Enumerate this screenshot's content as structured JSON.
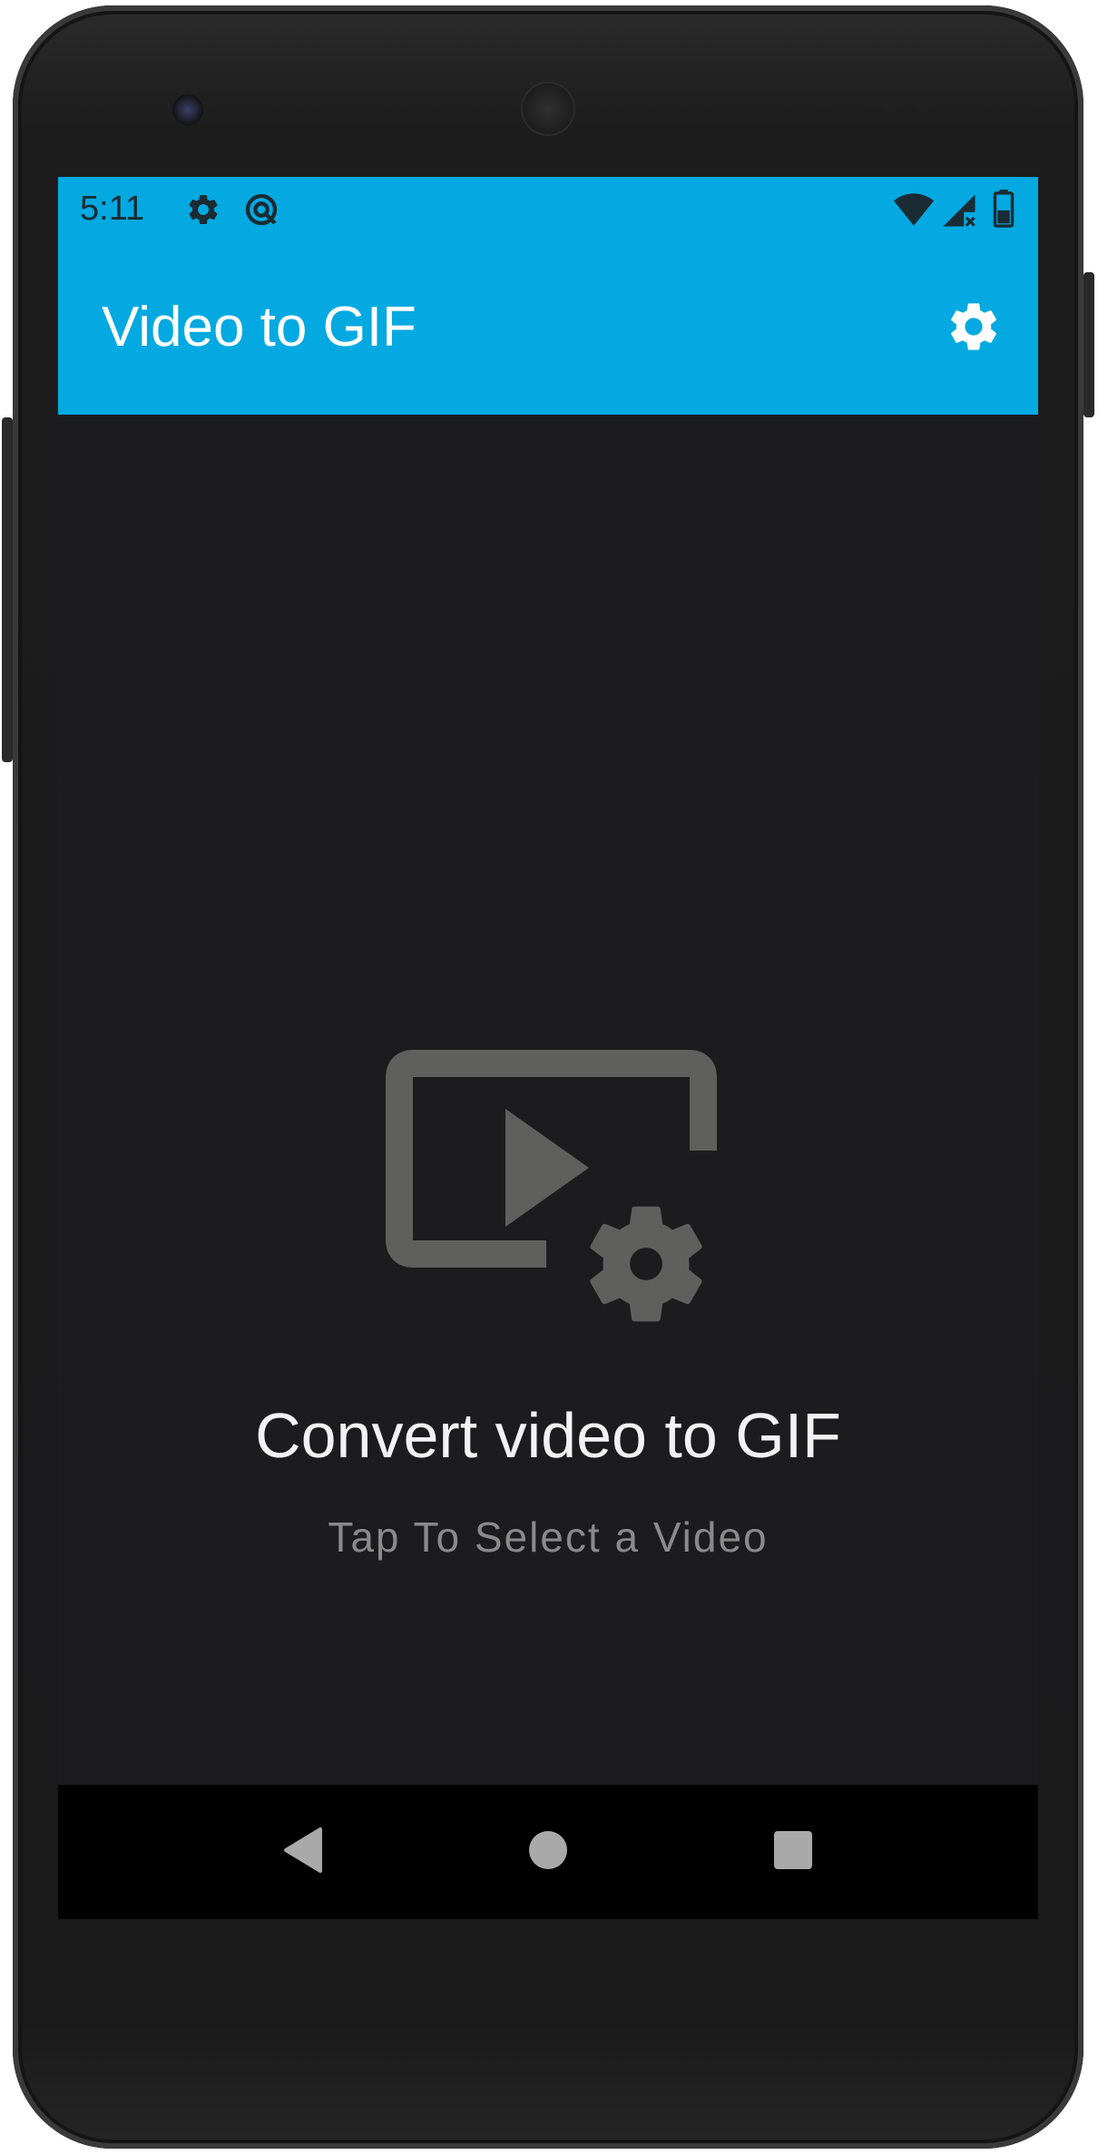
{
  "status_bar": {
    "time": "5:11",
    "left_icons": [
      "settings-icon",
      "notification-icon"
    ],
    "right_icons": [
      "wifi-icon",
      "signal-no-data-icon",
      "battery-icon"
    ],
    "color": "#03a9e0"
  },
  "app_bar": {
    "title": "Video to GIF",
    "action_icon": "settings-icon",
    "color": "#03a9e0"
  },
  "main": {
    "icon": "video-settings-icon",
    "title": "Convert video to GIF",
    "subtitle": "Tap To Select a Video",
    "background": "#1c1c1e",
    "icon_color": "#5f605e"
  },
  "nav_bar": {
    "buttons": [
      "back-icon",
      "home-icon",
      "recents-icon"
    ]
  }
}
